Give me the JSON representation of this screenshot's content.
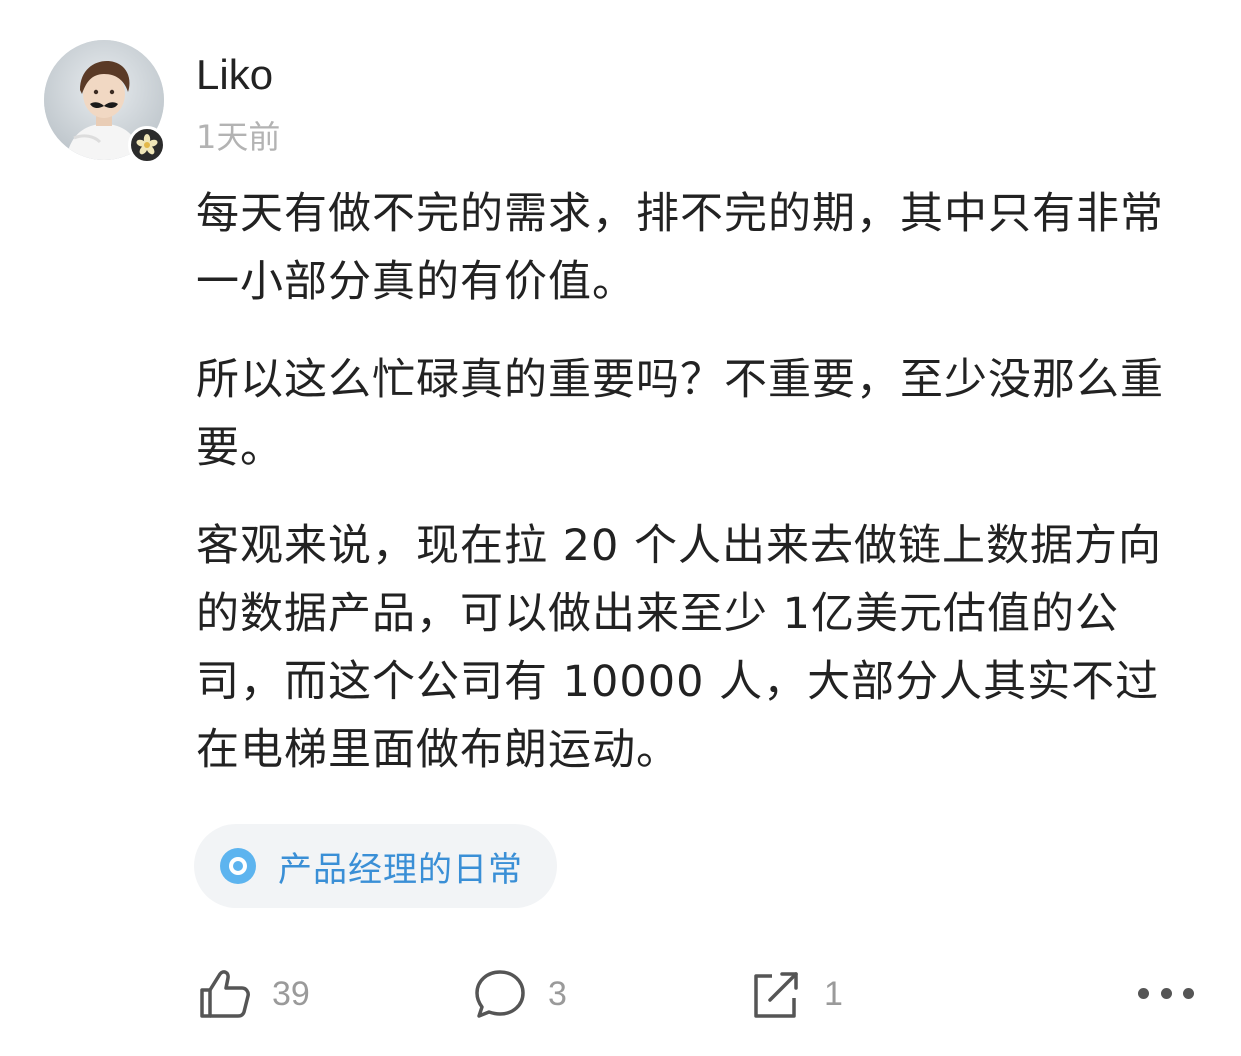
{
  "post": {
    "author": "Liko",
    "time": "1天前",
    "paragraphs": [
      "每天有做不完的需求，排不完的期，其中只有非常一小部分真的有价值。",
      "所以这么忙碌真的重要吗？不重要，至少没那么重要。",
      "客观来说，现在拉 20 个人出来去做链上数据方向的数据产品，可以做出来至少 1亿美元估值的公司，而这个公司有 10000 人，大部分人其实不过在电梯里面做布朗运动。"
    ],
    "topic_tag": "产品经理的日常"
  },
  "actions": {
    "like_count": "39",
    "comment_count": "3",
    "share_count": "1"
  },
  "icons": {
    "like": "thumbs-up-icon",
    "comment": "comment-bubble-icon",
    "share": "share-icon",
    "more": "more-dots-icon",
    "badge": "flower-badge-icon",
    "topic": "topic-circle-icon"
  },
  "colors": {
    "tag_text": "#3a8fd6",
    "tag_bg": "#f2f4f6",
    "muted": "#9a9a9a"
  }
}
